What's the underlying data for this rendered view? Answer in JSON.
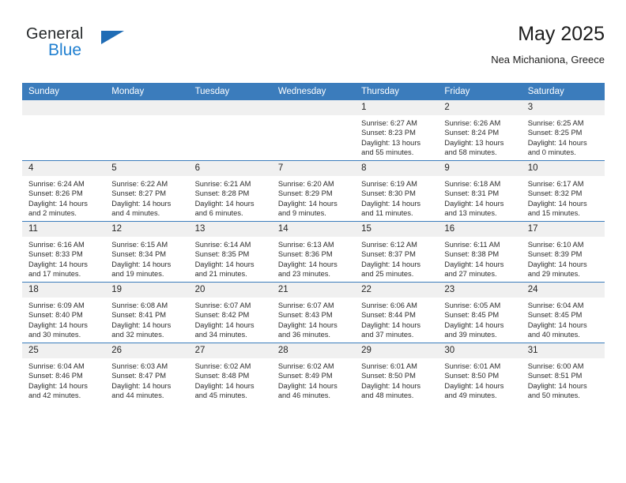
{
  "brand": {
    "name_part1": "General",
    "name_part2": "Blue",
    "triangle_color": "#1f6cb5",
    "blue_color": "#1f7fd0"
  },
  "header": {
    "title": "May 2025",
    "subtitle": "Nea Michaniona, Greece"
  },
  "colors": {
    "header_bar": "#3b7cbc",
    "daynum_band": "#f0f0f0",
    "grid_line": "#3b7cbc",
    "text": "#2c2c2c"
  },
  "weekday_headers": [
    "Sunday",
    "Monday",
    "Tuesday",
    "Wednesday",
    "Thursday",
    "Friday",
    "Saturday"
  ],
  "calendar": {
    "month": "May",
    "year": 2025,
    "weeks": [
      [
        {
          "empty": true
        },
        {
          "empty": true
        },
        {
          "empty": true
        },
        {
          "empty": true
        },
        {
          "day": "1",
          "sunrise": "Sunrise: 6:27 AM",
          "sunset": "Sunset: 8:23 PM",
          "daylight_line1": "Daylight: 13 hours",
          "daylight_line2": "and 55 minutes."
        },
        {
          "day": "2",
          "sunrise": "Sunrise: 6:26 AM",
          "sunset": "Sunset: 8:24 PM",
          "daylight_line1": "Daylight: 13 hours",
          "daylight_line2": "and 58 minutes."
        },
        {
          "day": "3",
          "sunrise": "Sunrise: 6:25 AM",
          "sunset": "Sunset: 8:25 PM",
          "daylight_line1": "Daylight: 14 hours",
          "daylight_line2": "and 0 minutes."
        }
      ],
      [
        {
          "day": "4",
          "sunrise": "Sunrise: 6:24 AM",
          "sunset": "Sunset: 8:26 PM",
          "daylight_line1": "Daylight: 14 hours",
          "daylight_line2": "and 2 minutes."
        },
        {
          "day": "5",
          "sunrise": "Sunrise: 6:22 AM",
          "sunset": "Sunset: 8:27 PM",
          "daylight_line1": "Daylight: 14 hours",
          "daylight_line2": "and 4 minutes."
        },
        {
          "day": "6",
          "sunrise": "Sunrise: 6:21 AM",
          "sunset": "Sunset: 8:28 PM",
          "daylight_line1": "Daylight: 14 hours",
          "daylight_line2": "and 6 minutes."
        },
        {
          "day": "7",
          "sunrise": "Sunrise: 6:20 AM",
          "sunset": "Sunset: 8:29 PM",
          "daylight_line1": "Daylight: 14 hours",
          "daylight_line2": "and 9 minutes."
        },
        {
          "day": "8",
          "sunrise": "Sunrise: 6:19 AM",
          "sunset": "Sunset: 8:30 PM",
          "daylight_line1": "Daylight: 14 hours",
          "daylight_line2": "and 11 minutes."
        },
        {
          "day": "9",
          "sunrise": "Sunrise: 6:18 AM",
          "sunset": "Sunset: 8:31 PM",
          "daylight_line1": "Daylight: 14 hours",
          "daylight_line2": "and 13 minutes."
        },
        {
          "day": "10",
          "sunrise": "Sunrise: 6:17 AM",
          "sunset": "Sunset: 8:32 PM",
          "daylight_line1": "Daylight: 14 hours",
          "daylight_line2": "and 15 minutes."
        }
      ],
      [
        {
          "day": "11",
          "sunrise": "Sunrise: 6:16 AM",
          "sunset": "Sunset: 8:33 PM",
          "daylight_line1": "Daylight: 14 hours",
          "daylight_line2": "and 17 minutes."
        },
        {
          "day": "12",
          "sunrise": "Sunrise: 6:15 AM",
          "sunset": "Sunset: 8:34 PM",
          "daylight_line1": "Daylight: 14 hours",
          "daylight_line2": "and 19 minutes."
        },
        {
          "day": "13",
          "sunrise": "Sunrise: 6:14 AM",
          "sunset": "Sunset: 8:35 PM",
          "daylight_line1": "Daylight: 14 hours",
          "daylight_line2": "and 21 minutes."
        },
        {
          "day": "14",
          "sunrise": "Sunrise: 6:13 AM",
          "sunset": "Sunset: 8:36 PM",
          "daylight_line1": "Daylight: 14 hours",
          "daylight_line2": "and 23 minutes."
        },
        {
          "day": "15",
          "sunrise": "Sunrise: 6:12 AM",
          "sunset": "Sunset: 8:37 PM",
          "daylight_line1": "Daylight: 14 hours",
          "daylight_line2": "and 25 minutes."
        },
        {
          "day": "16",
          "sunrise": "Sunrise: 6:11 AM",
          "sunset": "Sunset: 8:38 PM",
          "daylight_line1": "Daylight: 14 hours",
          "daylight_line2": "and 27 minutes."
        },
        {
          "day": "17",
          "sunrise": "Sunrise: 6:10 AM",
          "sunset": "Sunset: 8:39 PM",
          "daylight_line1": "Daylight: 14 hours",
          "daylight_line2": "and 29 minutes."
        }
      ],
      [
        {
          "day": "18",
          "sunrise": "Sunrise: 6:09 AM",
          "sunset": "Sunset: 8:40 PM",
          "daylight_line1": "Daylight: 14 hours",
          "daylight_line2": "and 30 minutes."
        },
        {
          "day": "19",
          "sunrise": "Sunrise: 6:08 AM",
          "sunset": "Sunset: 8:41 PM",
          "daylight_line1": "Daylight: 14 hours",
          "daylight_line2": "and 32 minutes."
        },
        {
          "day": "20",
          "sunrise": "Sunrise: 6:07 AM",
          "sunset": "Sunset: 8:42 PM",
          "daylight_line1": "Daylight: 14 hours",
          "daylight_line2": "and 34 minutes."
        },
        {
          "day": "21",
          "sunrise": "Sunrise: 6:07 AM",
          "sunset": "Sunset: 8:43 PM",
          "daylight_line1": "Daylight: 14 hours",
          "daylight_line2": "and 36 minutes."
        },
        {
          "day": "22",
          "sunrise": "Sunrise: 6:06 AM",
          "sunset": "Sunset: 8:44 PM",
          "daylight_line1": "Daylight: 14 hours",
          "daylight_line2": "and 37 minutes."
        },
        {
          "day": "23",
          "sunrise": "Sunrise: 6:05 AM",
          "sunset": "Sunset: 8:45 PM",
          "daylight_line1": "Daylight: 14 hours",
          "daylight_line2": "and 39 minutes."
        },
        {
          "day": "24",
          "sunrise": "Sunrise: 6:04 AM",
          "sunset": "Sunset: 8:45 PM",
          "daylight_line1": "Daylight: 14 hours",
          "daylight_line2": "and 40 minutes."
        }
      ],
      [
        {
          "day": "25",
          "sunrise": "Sunrise: 6:04 AM",
          "sunset": "Sunset: 8:46 PM",
          "daylight_line1": "Daylight: 14 hours",
          "daylight_line2": "and 42 minutes."
        },
        {
          "day": "26",
          "sunrise": "Sunrise: 6:03 AM",
          "sunset": "Sunset: 8:47 PM",
          "daylight_line1": "Daylight: 14 hours",
          "daylight_line2": "and 44 minutes."
        },
        {
          "day": "27",
          "sunrise": "Sunrise: 6:02 AM",
          "sunset": "Sunset: 8:48 PM",
          "daylight_line1": "Daylight: 14 hours",
          "daylight_line2": "and 45 minutes."
        },
        {
          "day": "28",
          "sunrise": "Sunrise: 6:02 AM",
          "sunset": "Sunset: 8:49 PM",
          "daylight_line1": "Daylight: 14 hours",
          "daylight_line2": "and 46 minutes."
        },
        {
          "day": "29",
          "sunrise": "Sunrise: 6:01 AM",
          "sunset": "Sunset: 8:50 PM",
          "daylight_line1": "Daylight: 14 hours",
          "daylight_line2": "and 48 minutes."
        },
        {
          "day": "30",
          "sunrise": "Sunrise: 6:01 AM",
          "sunset": "Sunset: 8:50 PM",
          "daylight_line1": "Daylight: 14 hours",
          "daylight_line2": "and 49 minutes."
        },
        {
          "day": "31",
          "sunrise": "Sunrise: 6:00 AM",
          "sunset": "Sunset: 8:51 PM",
          "daylight_line1": "Daylight: 14 hours",
          "daylight_line2": "and 50 minutes."
        }
      ]
    ]
  }
}
